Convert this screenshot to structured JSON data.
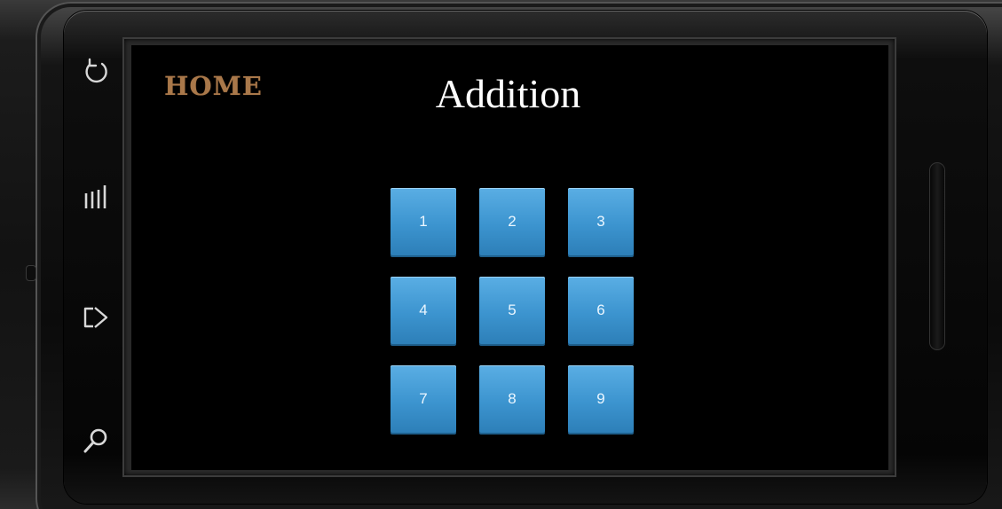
{
  "screen": {
    "home_label": "HOME",
    "title": "Addition",
    "keypad": [
      "1",
      "2",
      "3",
      "4",
      "5",
      "6",
      "7",
      "8",
      "9"
    ]
  },
  "device": {
    "side_keys": [
      "back-icon",
      "menu-icon",
      "home-icon",
      "search-icon"
    ]
  },
  "colors": {
    "home_text": "#a9784a",
    "key_top": "#5aaee4",
    "key_bottom": "#2d7fb8",
    "screen_bg": "#000000"
  }
}
